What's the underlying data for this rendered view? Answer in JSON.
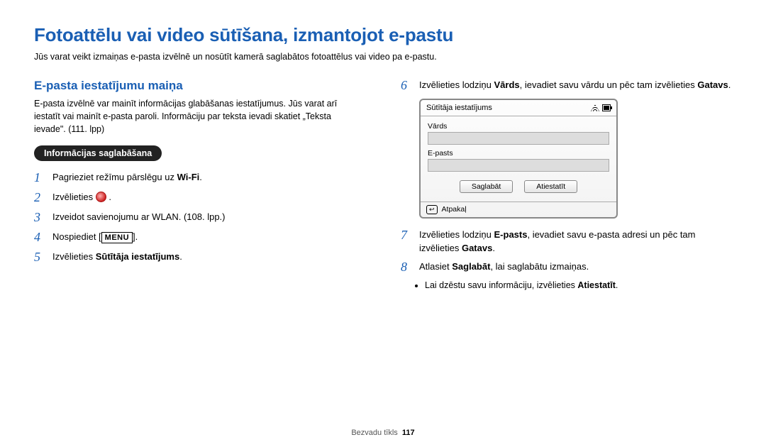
{
  "title": "Fotoattēlu vai video sūtīšana, izmantojot e-pastu",
  "intro": "Jūs varat veikt izmaiņas e-pasta izvēlnē un nosūtīt kamerā saglabātos fotoattēlus vai video pa e-pastu.",
  "left": {
    "heading": "E-pasta iestatījumu maiņa",
    "desc": "E-pasta izvēlnē var mainīt informācijas glabāšanas iestatījumus. Jūs varat arī iestatīt vai mainīt e-pasta paroli. Informāciju par teksta ievadi skatiet „Teksta ievade\". (111. lpp)",
    "pill": "Informācijas saglabāšana",
    "steps": {
      "1": "Pagrieziet režīmu pārslēgu uz ",
      "1_tail": ".",
      "wifi_label": "Wi-Fi",
      "2": "Izvēlieties ",
      "2_tail": " .",
      "3": "Izveidot savienojumu ar WLAN. (108. lpp.)",
      "4": "Nospiediet [",
      "4_tail": "].",
      "menu_label": "MENU",
      "5_pre": "Izvēlieties ",
      "5_bold": "Sūtītāja iestatījums",
      "5_tail": "."
    }
  },
  "right": {
    "steps": {
      "6_pre": "Izvēlieties lodziņu ",
      "6_bold1": "Vārds",
      "6_mid": ", ievadiet savu vārdu un pēc tam izvēlieties ",
      "6_bold2": "Gatavs",
      "6_tail": ".",
      "7_pre": "Izvēlieties lodziņu ",
      "7_bold1": "E-pasts",
      "7_mid": ", ievadiet savu e-pasta adresi un pēc tam izvēlieties ",
      "7_bold2": "Gatavs",
      "7_tail": ".",
      "8_pre": "Atlasiet ",
      "8_bold": "Saglabāt",
      "8_tail": ", lai saglabātu izmaiņas."
    },
    "bullet": "Lai dzēstu savu informāciju, izvēlieties ",
    "bullet_bold": "Atiestatīt",
    "bullet_tail": "."
  },
  "panel": {
    "title": "Sūtītāja iestatījums",
    "field1": "Vārds",
    "field2": "E-pasts",
    "btn_save": "Saglabāt",
    "btn_reset": "Atiestatīt",
    "back": "Atpakaļ"
  },
  "footer": {
    "section": "Bezvadu tīkls",
    "page": "117"
  }
}
